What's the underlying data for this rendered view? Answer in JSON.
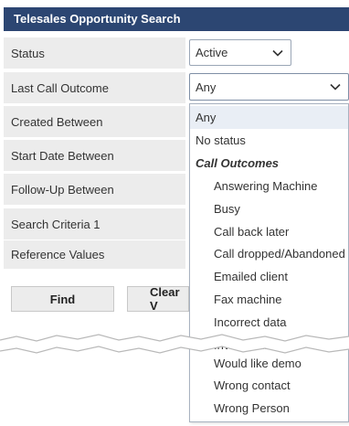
{
  "panel": {
    "title": "Telesales Opportunity Search"
  },
  "fields": [
    {
      "label": "Status"
    },
    {
      "label": "Last Call Outcome"
    },
    {
      "label": "Created Between"
    },
    {
      "label": "Start Date Between"
    },
    {
      "label": "Follow-Up Between"
    },
    {
      "label": "Search Criteria 1"
    },
    {
      "label": "Reference Values"
    }
  ],
  "status_select": {
    "value": "Active",
    "icon": "chevron-down-icon"
  },
  "outcome_select": {
    "value": "Any",
    "icon": "chevron-down-icon"
  },
  "buttons": {
    "find": "Find",
    "clear": "Clear V"
  },
  "dropdown": {
    "options": [
      {
        "label": "Any",
        "highlighted": true
      },
      {
        "label": "No status"
      },
      {
        "label": "Call Outcomes",
        "group": true
      },
      {
        "label": "Answering Machine"
      },
      {
        "label": "Busy"
      },
      {
        "label": "Call back later"
      },
      {
        "label": "Call dropped/Abandoned"
      },
      {
        "label": "Emailed client"
      },
      {
        "label": "Fax machine"
      },
      {
        "label": "Incorrect data"
      },
      {
        "label": "Invalid number"
      },
      {
        "label": "Would like demo"
      },
      {
        "label": "Wrong contact"
      },
      {
        "label": "Wrong Person"
      }
    ]
  },
  "colors": {
    "title_bar": "#2c4672",
    "label_bg": "#ececec",
    "highlight": "#e9eef5"
  }
}
